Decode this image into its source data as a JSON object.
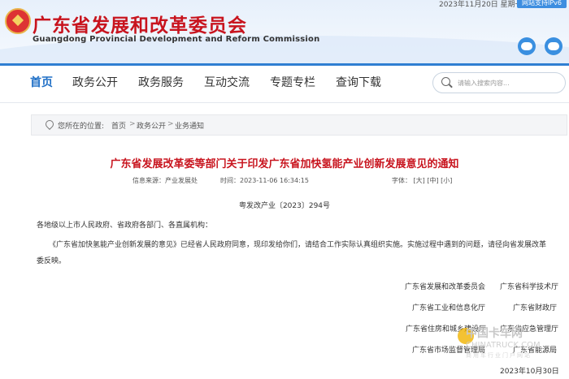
{
  "header": {
    "title": "广东省发展和改革委员会",
    "subtitle": "Guangdong Provincial Development and Reform Commission",
    "date": "2023年11月20日  星期一",
    "support": "网站支持IPv6"
  },
  "nav": {
    "items": [
      {
        "label": "首页"
      },
      {
        "label": "政务公开"
      },
      {
        "label": "政务服务"
      },
      {
        "label": "互动交流"
      },
      {
        "label": "专题专栏"
      },
      {
        "label": "查询下载"
      }
    ],
    "search_placeholder": "请输入搜索内容..."
  },
  "breadcrumb": {
    "label": "您所在的位置:",
    "items": [
      "首页",
      "政务公开",
      "业务通知"
    ]
  },
  "article": {
    "title": "广东省发展改革委等部门关于印发广东省加快氢能产业创新发展意见的通知",
    "source": "信息来源：产业发展处",
    "time": "时间：2023-11-06 16:34:15",
    "font_label": "字体：",
    "font_sizes": [
      "[大]",
      "[中]",
      "[小]"
    ],
    "doc_number": "粤发改产业〔2023〕294号",
    "salutation": "各地级以上市人民政府、省政府各部门、各直属机构：",
    "body_line1": "《广东省加快氢能产业创新发展的意见》已经省人民政府同意，现印发给你们，请结合工作实际认真组织实施。实施过程中遇到的问题，请径向省发展改革",
    "body_line2": "委反映。",
    "signatories": [
      [
        "广东省发展和改革委员会",
        "广东省科学技术厅"
      ],
      [
        "广东省工业和信息化厅",
        "广东省财政厅"
      ],
      [
        "广东省住房和城乡建设厅",
        "广东省应急管理厅"
      ],
      [
        "广东省市场监督管理局",
        "广东省能源局"
      ]
    ],
    "date": "2023年10月30日"
  },
  "watermark": {
    "cn": "中国卡车网",
    "en": "CHINATRUCK.COM",
    "tag": "商用车行业门户网站"
  }
}
